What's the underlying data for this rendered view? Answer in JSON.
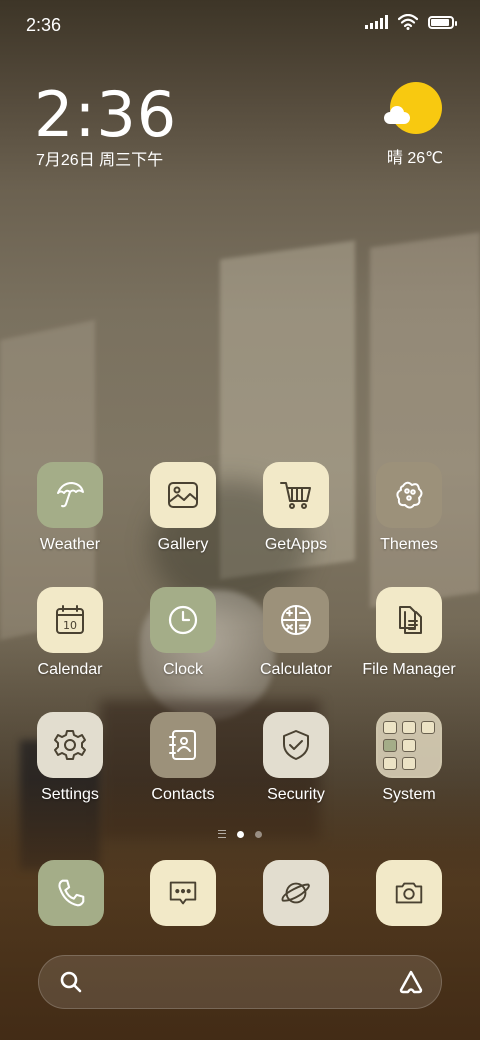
{
  "status_bar": {
    "time": "2:36"
  },
  "clock_widget": {
    "time": "2:36",
    "date": "7月26日 周三下午"
  },
  "weather_widget": {
    "text": "晴 26℃",
    "icon": "sun-cloud-icon"
  },
  "apps": [
    {
      "label": "Weather",
      "icon": "umbrella-icon",
      "color": "#a4ad88"
    },
    {
      "label": "Gallery",
      "icon": "image-icon",
      "color": "#f2e9c8"
    },
    {
      "label": "GetApps",
      "icon": "cart-icon",
      "color": "#f2e9c8"
    },
    {
      "label": "Themes",
      "icon": "palette-icon",
      "color": "#9c917a"
    },
    {
      "label": "Calendar",
      "icon": "calendar-icon",
      "color": "#f2e9c8",
      "day": "10"
    },
    {
      "label": "Clock",
      "icon": "clock-icon",
      "color": "#a4ad88"
    },
    {
      "label": "Calculator",
      "icon": "calculator-icon",
      "color": "#9c917a"
    },
    {
      "label": "File Manager",
      "icon": "files-icon",
      "color": "#f2e9c8"
    },
    {
      "label": "Settings",
      "icon": "gear-icon",
      "color": "#e2ddcf"
    },
    {
      "label": "Contacts",
      "icon": "contacts-book-icon",
      "color": "#9c917a"
    },
    {
      "label": "Security",
      "icon": "shield-check-icon",
      "color": "#e2ddcf"
    },
    {
      "label": "System",
      "icon": "folder-icon",
      "color": "#e1d7be"
    }
  ],
  "page_indicator": {
    "pages": 2,
    "active": 1
  },
  "dock": [
    {
      "icon": "phone-icon",
      "color": "#a4ad88"
    },
    {
      "icon": "message-icon",
      "color": "#f2e9c8"
    },
    {
      "icon": "browser-planet-icon",
      "color": "#e2ddcf"
    },
    {
      "icon": "camera-icon",
      "color": "#f2e9c8"
    }
  ],
  "search_bar": {
    "left_icon": "search-icon",
    "right_icon": "assistant-icon"
  }
}
